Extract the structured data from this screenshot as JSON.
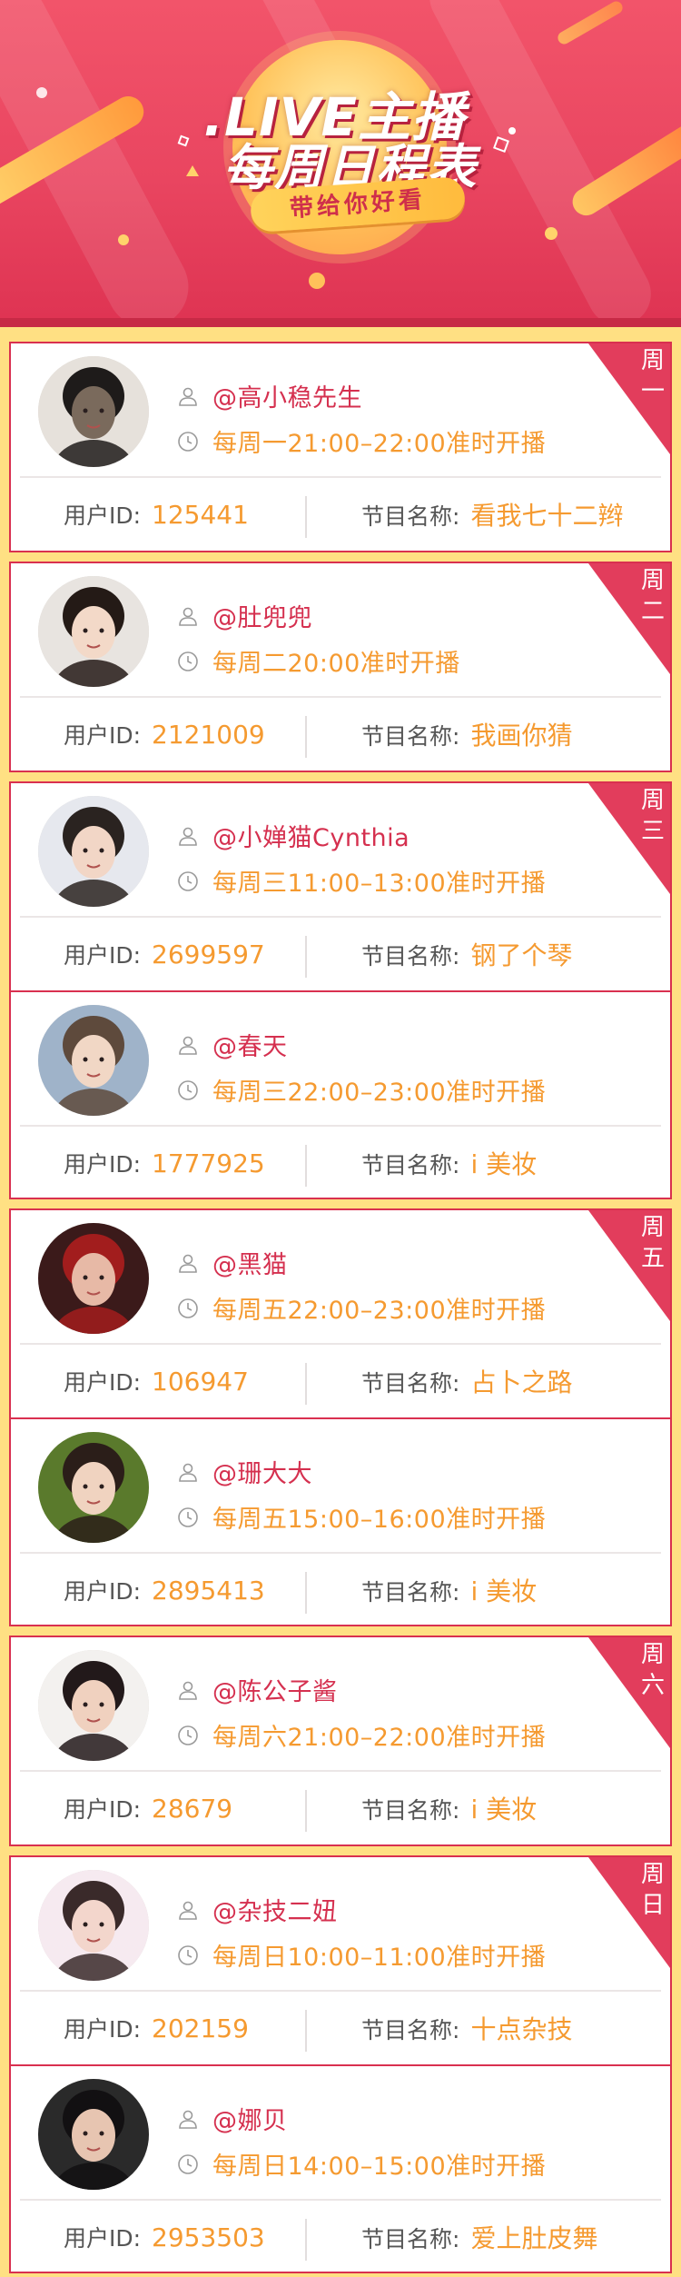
{
  "header": {
    "title_line1": ".LIVE主播",
    "title_line2": "每周日程表",
    "slogan": "带给你好看"
  },
  "labels": {
    "user_id": "用户ID:",
    "program": "节目名称:"
  },
  "colors": {
    "accent": "#d9304f",
    "time_text": "#f59a30",
    "background": "#ffe083"
  },
  "icons": {
    "name": "user-icon",
    "time": "clock-icon"
  },
  "days": [
    {
      "day": "周一",
      "entries": [
        {
          "name": "@高小稳先生",
          "time": "每周一21:00–22:00准时开播",
          "user_id": "125441",
          "program": "看我七十二辫"
        }
      ]
    },
    {
      "day": "周二",
      "entries": [
        {
          "name": "@肚兜兜",
          "time": "每周二20:00准时开播",
          "user_id": "2121009",
          "program": "我画你猜"
        }
      ]
    },
    {
      "day": "周三",
      "entries": [
        {
          "name": "@小婵猫Cynthia",
          "time": "每周三11:00–13:00准时开播",
          "user_id": "2699597",
          "program": "钢了个琴"
        },
        {
          "name": "@春天",
          "time": "每周三22:00–23:00准时开播",
          "user_id": "1777925",
          "program": "i 美妆"
        }
      ]
    },
    {
      "day": "周五",
      "entries": [
        {
          "name": "@黑猫",
          "time": "每周五22:00–23:00准时开播",
          "user_id": "106947",
          "program": "占卜之路"
        },
        {
          "name": "@珊大大",
          "time": "每周五15:00–16:00准时开播",
          "user_id": "2895413",
          "program": "i 美妆"
        }
      ]
    },
    {
      "day": "周六",
      "entries": [
        {
          "name": " @陈公子酱",
          "time": "每周六21:00–22:00准时开播",
          "user_id": "28679",
          "program": "i 美妆"
        }
      ]
    },
    {
      "day": "周日",
      "entries": [
        {
          "name": "@杂技二妞",
          "time": "每周日10:00–11:00准时开播",
          "user_id": "202159",
          "program": "十点杂技"
        },
        {
          "name": "@娜贝",
          "time": "每周日14:00–15:00准时开播",
          "user_id": "2953503",
          "program": "爱上肚皮舞"
        }
      ]
    }
  ]
}
